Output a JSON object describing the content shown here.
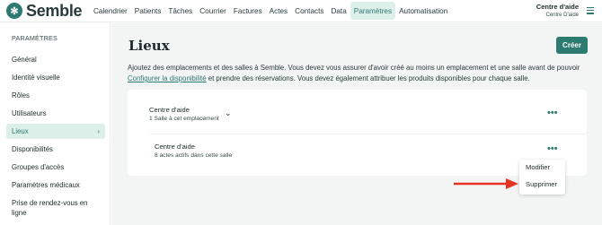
{
  "app": {
    "logo_text": "Semble"
  },
  "nav": {
    "items": [
      "Calendrier",
      "Patients",
      "Tâches",
      "Courrier",
      "Factures",
      "Actes",
      "Contacts",
      "Data",
      "Paramètres",
      "Automatisation"
    ],
    "active": "Paramètres"
  },
  "account": {
    "name": "Centre d'aide",
    "sub": "Centre D'aide"
  },
  "sidebar": {
    "title": "PARAMÈTRES",
    "items": [
      {
        "label": "Général"
      },
      {
        "label": "Identité visuelle"
      },
      {
        "label": "Rôles"
      },
      {
        "label": "Utilisateurs"
      },
      {
        "label": "Lieux",
        "chevron": "›"
      },
      {
        "label": "Disponibilités"
      },
      {
        "label": "Groupes d'accès"
      },
      {
        "label": "Paramètres médicaux"
      },
      {
        "label": "Prise de rendez-vous en ligne"
      }
    ]
  },
  "main": {
    "title": "Lieux",
    "create_label": "Créer",
    "desc_part1": "Ajoutez des emplacements et des salles à Semble. Vous devez vous assurer d'avoir créé au moins un emplacement et une salle avant de pouvoir",
    "desc_link": "Configurer la disponibilité",
    "desc_part2": " et prendre des réservations. Vous devez également attribuer les produits disponibles pour chaque salle.",
    "location": {
      "title": "Centre d'aide",
      "subtitle": "1 Salle à cet emplacement",
      "chevron": "⌄"
    },
    "room": {
      "title": "Centre d'aide",
      "subtitle": "8 actes actifs dans cette salle"
    },
    "dots": "•••",
    "dropdown": {
      "edit": "Modifier",
      "delete": "Supprimer"
    }
  },
  "colors": {
    "accent": "#2d7a70",
    "annotation_arrow": "#e53222"
  }
}
